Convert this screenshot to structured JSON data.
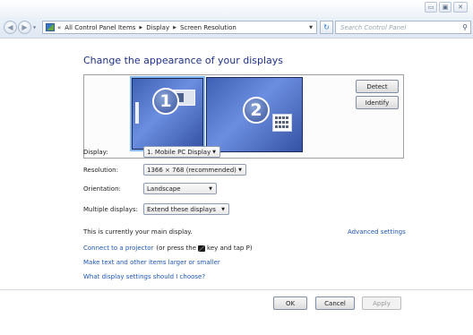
{
  "window": {
    "controls": {
      "minimize": "▭",
      "maximize": "▣",
      "close": "✕"
    }
  },
  "address": {
    "lead": "«",
    "crumbs": [
      "All Control Panel Items",
      "Display",
      "Screen Resolution"
    ],
    "search_placeholder": "Search Control Panel"
  },
  "page": {
    "title": "Change the appearance of your displays"
  },
  "preview": {
    "monitor1_number": "1",
    "monitor2_number": "2",
    "detect_label": "Detect",
    "identify_label": "Identify"
  },
  "settings": {
    "display": {
      "label": "Display:",
      "value": "1. Mobile PC Display"
    },
    "resolution": {
      "label": "Resolution:",
      "value": "1366 × 768 (recommended)"
    },
    "orientation": {
      "label": "Orientation:",
      "value": "Landscape"
    },
    "multiple": {
      "label": "Multiple displays:",
      "value": "Extend these displays"
    }
  },
  "notes": {
    "main_display": "This is currently your main display.",
    "advanced": "Advanced settings",
    "projector_link": "Connect to a projector",
    "projector_hint_a": "(or press the",
    "projector_hint_b": "key and tap P)",
    "text_size_link": "Make text and other items larger or smaller",
    "which_settings_link": "What display settings should I choose?"
  },
  "footer": {
    "ok": "OK",
    "cancel": "Cancel",
    "apply": "Apply"
  },
  "colors": {
    "title": "#1e3287",
    "link": "#1e56b3",
    "monitor": "#3f61b5",
    "selected_outline": "#86b9f3"
  }
}
